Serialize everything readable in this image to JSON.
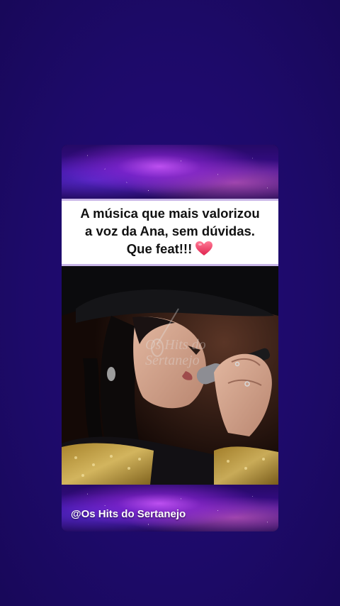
{
  "caption": {
    "line1": "A música que mais valorizou",
    "line2": "a voz da Ana, sem dúvidas.",
    "line3": "Que feat!!!",
    "emoji": "heart-icon"
  },
  "video": {
    "watermark_line1": "Os Hits do",
    "watermark_line2": "Sertanejo"
  },
  "footer": {
    "handle": "@Os Hits do Sertanejo"
  },
  "colors": {
    "background": "#1f0a6e",
    "caption_bg": "#ffffff",
    "caption_border": "#c9b6e8",
    "heart": "#e8385f"
  }
}
